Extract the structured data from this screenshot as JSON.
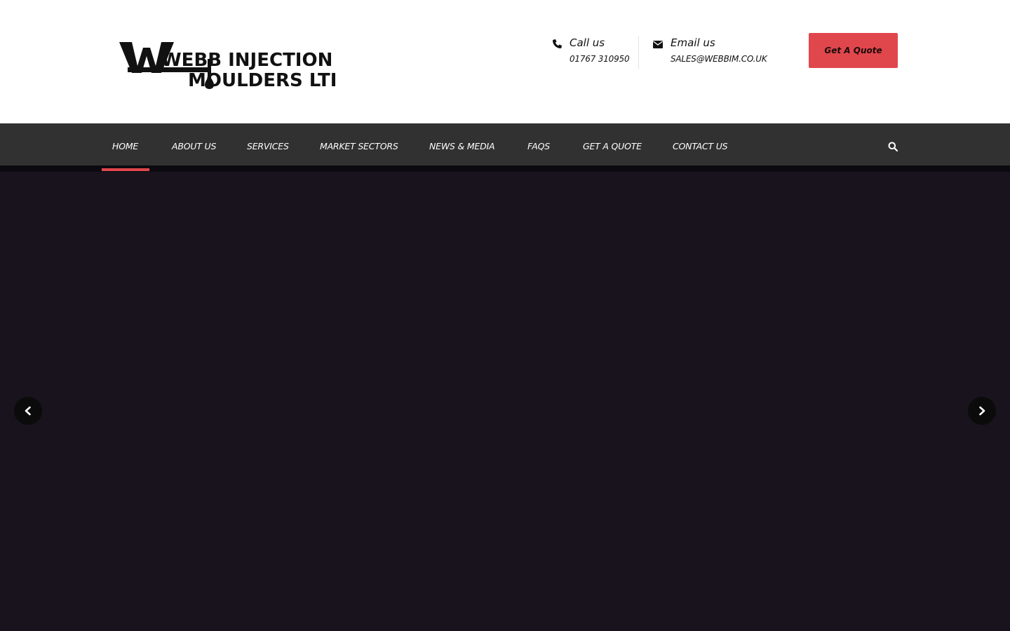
{
  "brand": {
    "line1": "WEBB INJECTION",
    "line2": "MOULDERS LTD"
  },
  "contact": {
    "call": {
      "title": "Call us",
      "value": "01767 310950",
      "icon": "phone-icon"
    },
    "email": {
      "title": "Email us",
      "value": "SALES@WEBBIM.CO.UK",
      "icon": "envelope-icon"
    }
  },
  "header": {
    "quote_button": "Get A Quote"
  },
  "nav": {
    "items": [
      {
        "label": "HOME",
        "active": true
      },
      {
        "label": "ABOUT US"
      },
      {
        "label": "SERVICES"
      },
      {
        "label": "MARKET SECTORS"
      },
      {
        "label": "NEWS & MEDIA"
      },
      {
        "label": "FAQS"
      },
      {
        "label": "GET A QUOTE"
      },
      {
        "label": "CONTACT US"
      }
    ],
    "search_icon": "search-icon"
  },
  "slider": {
    "prev_icon": "chevron-left-icon",
    "next_icon": "chevron-right-icon"
  },
  "colors": {
    "accent": "#e0474c",
    "nav_bg": "#313131",
    "hero_bg": "#18131c"
  }
}
